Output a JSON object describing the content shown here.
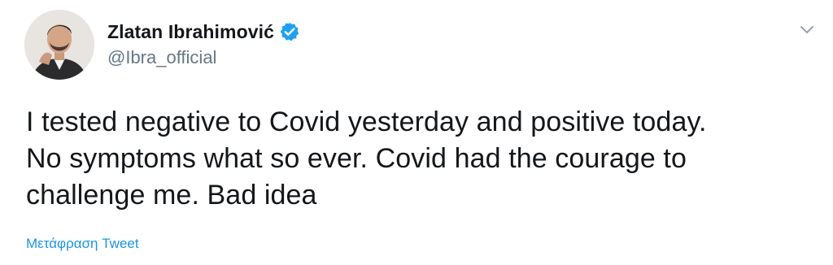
{
  "tweet": {
    "author": {
      "display_name": "Zlatan Ibrahimović",
      "handle": "@Ibra_official",
      "verified": true,
      "avatar_icon": "profile-photo"
    },
    "text_lines": [
      "I tested negative to Covid yesterday and positive today.",
      "No symptoms what so ever. Covid had the courage to",
      "challenge me. Bad idea"
    ],
    "translate_label": "Μετάφραση Tweet",
    "menu_icon": "chevron-down-icon"
  },
  "colors": {
    "text": "#14171a",
    "secondary": "#657786",
    "link": "#1b95e0",
    "verified_badge": "#1da1f2"
  }
}
